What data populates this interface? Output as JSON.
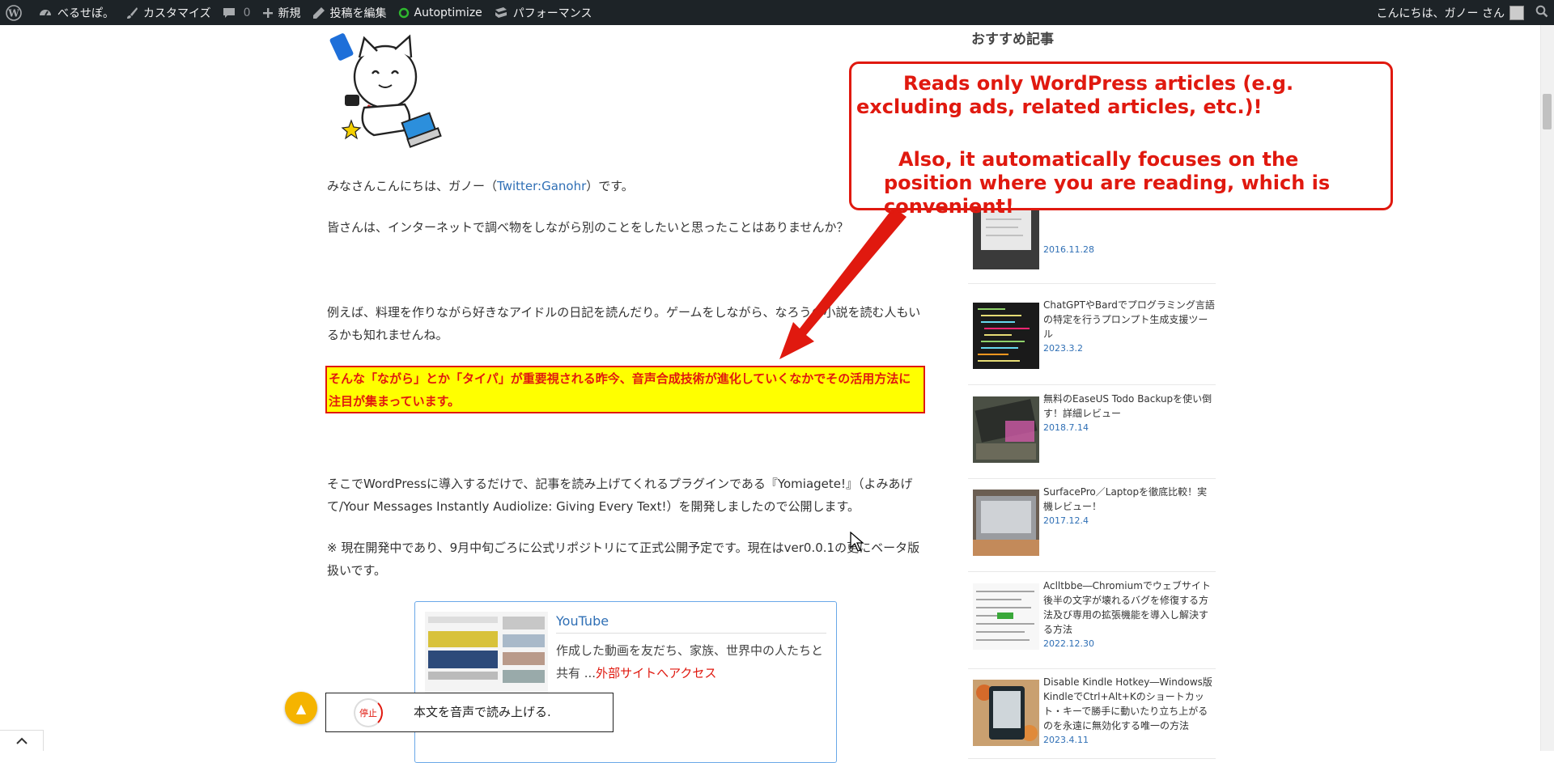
{
  "adminbar": {
    "site_name": "べるせぽ。",
    "customize": "カスタマイズ",
    "comments_count": "0",
    "new": "新規",
    "edit_post": "投稿を編集",
    "autoptimize": "Autoptimize",
    "performance": "パフォーマンス",
    "greeting": "こんにちは、ガノー さん"
  },
  "article": {
    "p1_prefix": "みなさんこんにちは、ガノー（",
    "p1_link": "Twitter:Ganohr",
    "p1_suffix": "）です。",
    "p2": "皆さんは、インターネットで調べ物をしながら別のことをしたいと思ったことはありませんか？",
    "p3": "例えば、料理を作りながら好きなアイドルの日記を読んだり。ゲームをしながら、なろうの小説を読む人もいるかも知れませんね。",
    "highlight": "そんな「ながら」とか「タイパ」が重要視される昨今、音声合成技術が進化していくなかでその活用方法に注目が集まっています。",
    "p4": "そこでWordPressに導入するだけで、記事を読み上げてくれるプラグインである『Yomiagete!』（よみあげて/Your Messages Instantly Audiolize: Giving Every Text!）を開発しましたので公開します。",
    "p5": "※ 現在開発中であり、9月中旬ごろに公式リポジトリにて正式公開予定です。現在はver0.0.1の更にベータ版扱いです。"
  },
  "embed": {
    "title": "YouTube",
    "desc": "作成した動画を友だち、家族、世界中の人たちと共有 ...",
    "link": "外部サイトへアクセス"
  },
  "sidebar": {
    "heading": "おすすめ記事",
    "items": [
      {
        "title": "",
        "date": "2016.11.28"
      },
      {
        "title": "ChatGPTやBardでプログラミング言語の特定を行うプロンプト生成支援ツール",
        "date": "2023.3.2"
      },
      {
        "title": "無料のEaseUS Todo Backupを使い倒す！詳細レビュー",
        "date": "2018.7.14"
      },
      {
        "title": "SurfacePro／Laptopを徹底比較！実機レビュー！",
        "date": "2017.12.4"
      },
      {
        "title": "Aclltbbe―Chromiumでウェブサイト後半の文字が壊れるバグを修復する方法及び専用の拡張機能を導入し解決する方法",
        "date": "2022.12.30"
      },
      {
        "title": "Disable Kindle Hotkey―Windows版KindleでCtrl+Alt+Kのショートカット・キーで勝手に動いたり立ち上がるのを永遠に無効化する唯一の方法",
        "date": "2023.4.11"
      }
    ]
  },
  "callout": {
    "line1": "Reads only WordPress articles (e.g. excluding ads, related articles, etc.)!",
    "line2": "Also, it automatically focuses on the position where you are reading, which is convenient!"
  },
  "player": {
    "stop": "停止",
    "label": "本文を音声で読み上げる."
  },
  "colors": {
    "accent_red": "#e0190f",
    "highlight_yellow": "#ffff00",
    "link_blue": "#2f6fb5",
    "adminbar_bg": "#1d2327"
  }
}
